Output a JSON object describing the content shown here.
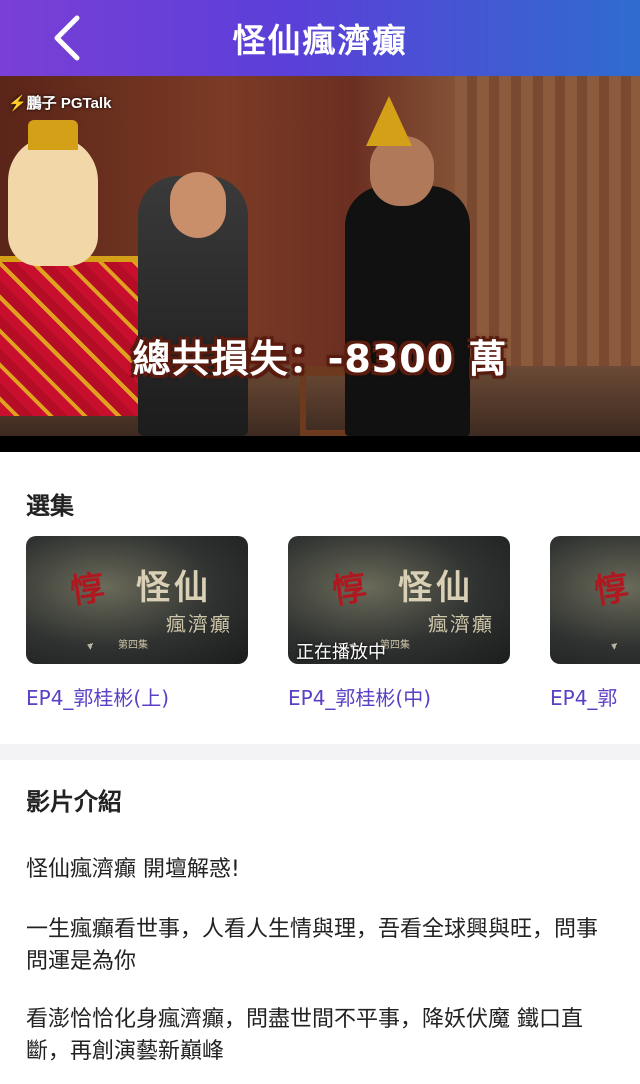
{
  "header": {
    "back_icon": "chevron-left-icon",
    "title": "怪仙瘋濟癲"
  },
  "player": {
    "watermark": "⚡鵬子 PGTalk",
    "caption": "總共損失：-8300 萬"
  },
  "episodes": {
    "section_title": "選集",
    "items": [
      {
        "label": "EP4_郭桂彬(上)",
        "thumb_title": "怪仙",
        "thumb_sub": "瘋濟癲",
        "thumb_red": "惇",
        "thumb_ep": "第四集",
        "status": ""
      },
      {
        "label": "EP4_郭桂彬(中)",
        "thumb_title": "怪仙",
        "thumb_sub": "瘋濟癲",
        "thumb_red": "惇",
        "thumb_ep": "第四集",
        "status": "正在播放中"
      },
      {
        "label": "EP4_郭",
        "thumb_title": "",
        "thumb_sub": "",
        "thumb_red": "惇",
        "thumb_ep": "",
        "status": ""
      }
    ]
  },
  "description": {
    "section_title": "影片介紹",
    "paragraphs": [
      "怪仙瘋濟癲 開壇解惑!",
      "一生瘋癲看世事，人看人生情與理，吾看全球興與旺，問事問運是為你",
      "看澎恰恰化身瘋濟癲，問盡世間不平事，降妖伏魔 鐵口直斷，再創演藝新巔峰"
    ]
  },
  "colors": {
    "header_gradient_start": "#7a3fd6",
    "header_gradient_end": "#2f6ccf",
    "episode_label": "#5b3fc4"
  }
}
